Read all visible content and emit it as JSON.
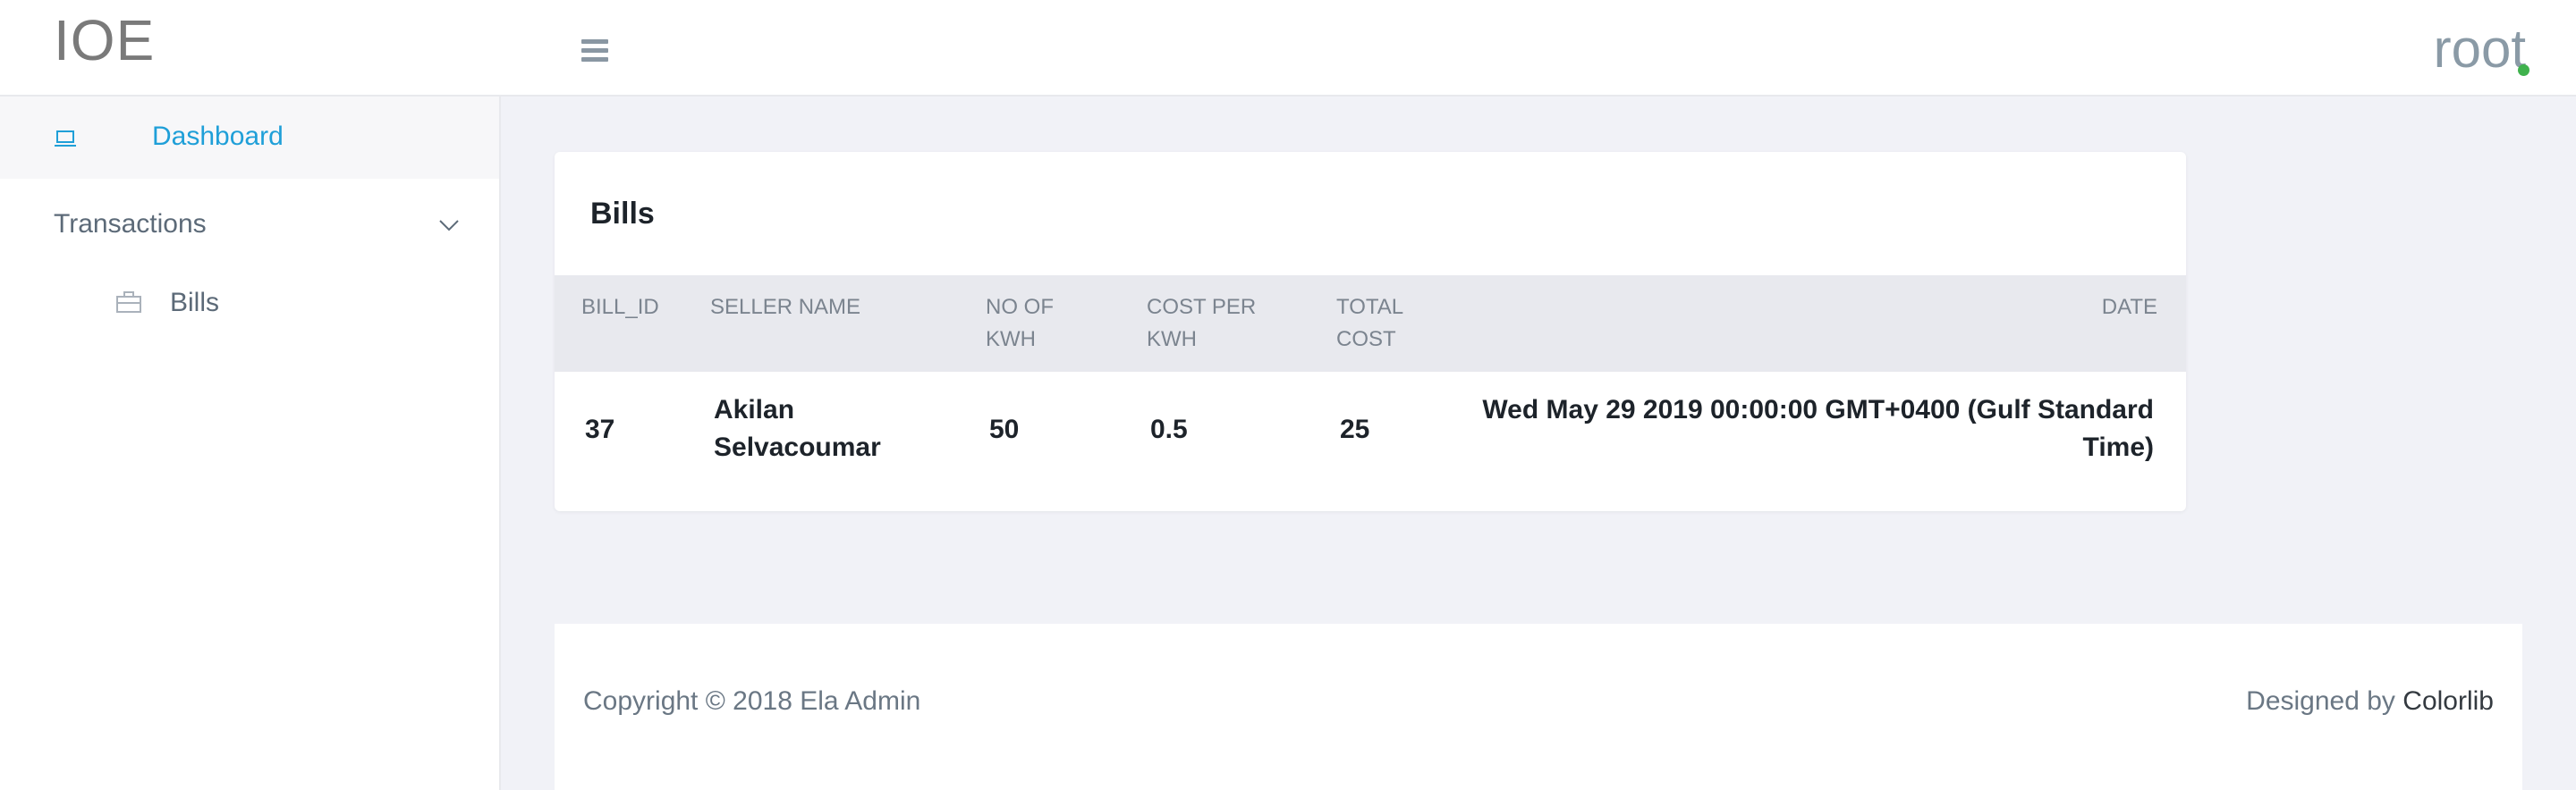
{
  "brand": {
    "title": "IOE"
  },
  "header": {
    "user_name": "root",
    "status_color": "#3fb24d",
    "menu_icon": "hamburger-icon"
  },
  "sidebar": {
    "items": [
      {
        "label": "Dashboard",
        "icon": "laptop-icon",
        "active": true
      },
      {
        "label": "Transactions",
        "icon": "chevron-down-icon"
      },
      {
        "label": "Bills",
        "icon": "briefcase-icon"
      }
    ]
  },
  "card": {
    "title": "Bills",
    "columns": [
      {
        "line1": "",
        "line2": "BILL_ID"
      },
      {
        "line1": "",
        "line2": "SELLER NAME"
      },
      {
        "line1": "NO OF",
        "line2": "KWH"
      },
      {
        "line1": "COST PER",
        "line2": "KWH"
      },
      {
        "line1": "TOTAL",
        "line2": "COST"
      },
      {
        "line1": "",
        "line2": "DATE"
      }
    ],
    "rows": [
      {
        "bill_id": "37",
        "seller_line1": "Akilan",
        "seller_line2": "Selvacoumar",
        "kwh": "50",
        "cost_per_kwh": "0.5",
        "total_cost": "25",
        "date_line1": "Wed May 29 2019 00:00:00 GMT+0400 (Gulf Standard",
        "date_line2": "Time)"
      }
    ]
  },
  "footer": {
    "copyright": "Copyright © 2018 Ela Admin",
    "designed_prefix": "Designed by",
    "designed_link": "Colorlib"
  },
  "colors": {
    "accent": "#1f9fd8",
    "background": "#f1f2f7"
  }
}
